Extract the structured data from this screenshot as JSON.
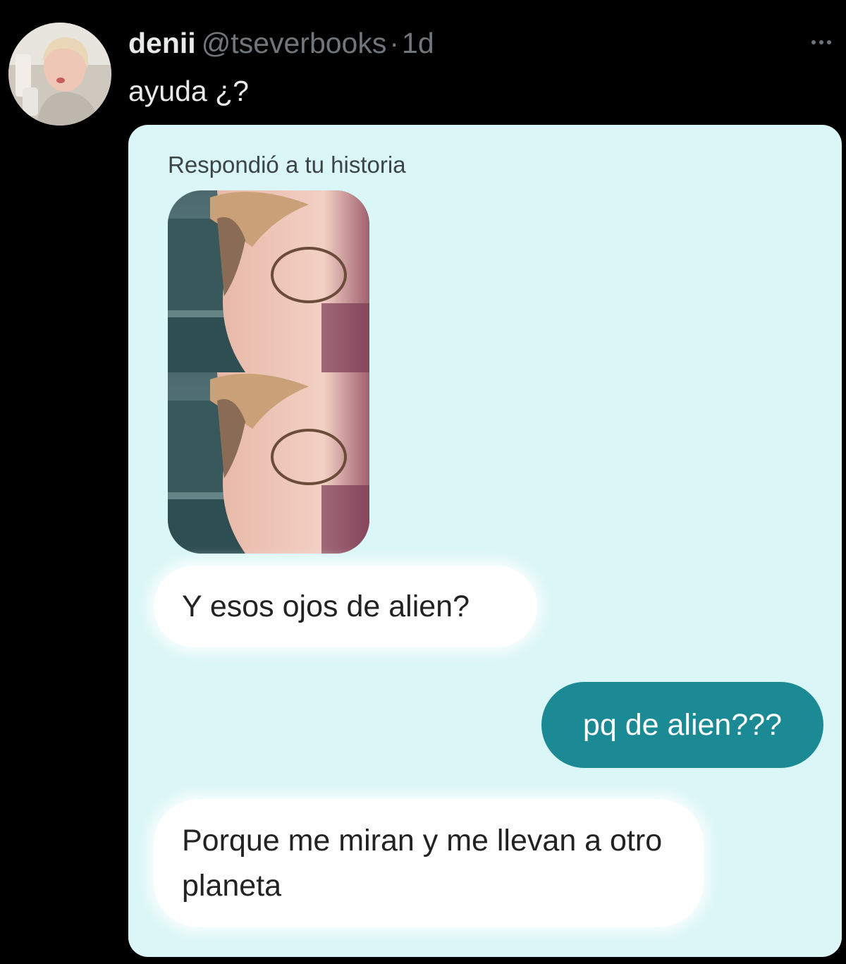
{
  "tweet": {
    "display_name": "denii",
    "handle": "@tseverbooks",
    "separator": "·",
    "time": "1d",
    "text": "ayuda ¿?"
  },
  "screenshot": {
    "story_reply_label": "Respondió a tu historia",
    "messages": [
      {
        "side": "received",
        "text": "Y esos ojos de alien?"
      },
      {
        "side": "sent",
        "text": "pq de alien???"
      },
      {
        "side": "received",
        "text": "Porque me miran y me llevan a otro planeta"
      }
    ]
  },
  "icons": {
    "more": "more-options-icon"
  },
  "colors": {
    "background": "#000000",
    "name": "#e7e9ea",
    "secondary_text": "#71767b",
    "chat_background": "#dbf6f6",
    "sent_bubble": "#1c8a94",
    "received_bubble": "#ffffff"
  }
}
